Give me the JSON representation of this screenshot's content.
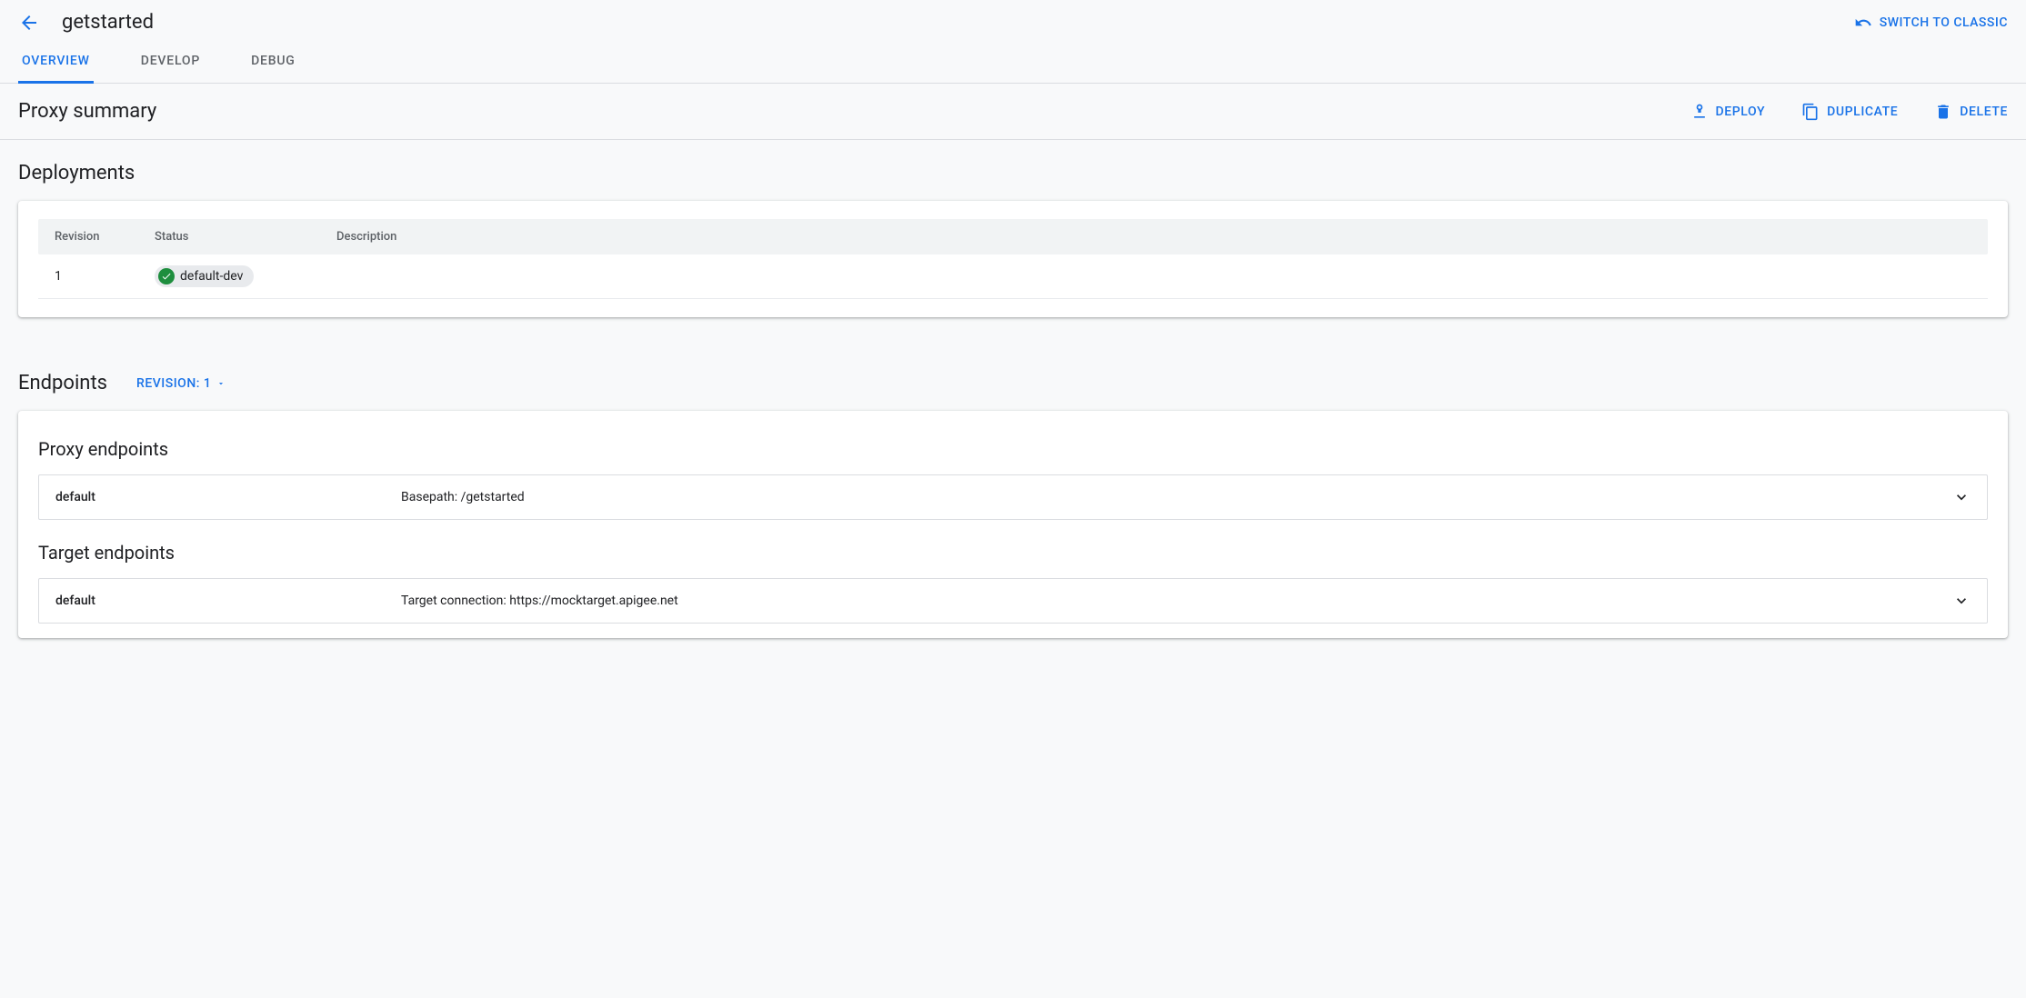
{
  "header": {
    "title": "getstarted",
    "switch_label": "SWITCH TO CLASSIC"
  },
  "tabs": {
    "overview": "OVERVIEW",
    "develop": "DEVELOP",
    "debug": "DEBUG"
  },
  "summary": {
    "title": "Proxy summary",
    "deploy": "DEPLOY",
    "duplicate": "DUPLICATE",
    "delete": "DELETE"
  },
  "deployments": {
    "title": "Deployments",
    "columns": {
      "revision": "Revision",
      "status": "Status",
      "description": "Description"
    },
    "rows": [
      {
        "revision": "1",
        "status": "default-dev",
        "description": ""
      }
    ]
  },
  "endpoints": {
    "title": "Endpoints",
    "revision_label": "REVISION: 1",
    "proxy_title": "Proxy endpoints",
    "target_title": "Target endpoints",
    "proxy": [
      {
        "name": "default",
        "detail": "Basepath: /getstarted"
      }
    ],
    "target": [
      {
        "name": "default",
        "detail": "Target connection: https://mocktarget.apigee.net"
      }
    ]
  }
}
